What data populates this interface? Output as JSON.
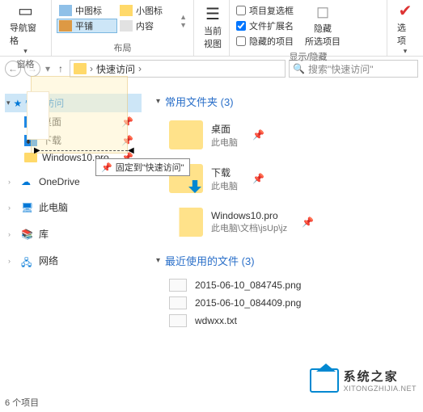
{
  "ribbon": {
    "panes": {
      "label": "窗格",
      "navpane": "导航窗格"
    },
    "layout": {
      "label": "布局",
      "medium": "中图标",
      "tiles": "平铺",
      "smallicons": "小图标",
      "content": "内容"
    },
    "currentview": {
      "label": "当前\n视图"
    },
    "showhide": {
      "label": "显示/隐藏",
      "checkboxes": "项目复选框",
      "extensions": "文件扩展名",
      "hiddenitems": "隐藏的项目",
      "hideBtn": "隐藏\n所选项目"
    },
    "options": "选项"
  },
  "breadcrumb": {
    "root": "快速访问",
    "sep": "›"
  },
  "search": {
    "placeholder": "搜索\"快速访问\""
  },
  "nav": {
    "quick": "快速访问",
    "desktop": "桌面",
    "downloads": "下载",
    "winpro": "Windows10.pro",
    "onedrive": "OneDrive",
    "thispc": "此电脑",
    "libraries": "库",
    "network": "网络"
  },
  "content": {
    "freqTitle": "常用文件夹 (3)",
    "recentTitle": "最近使用的文件 (3)",
    "folders": [
      {
        "name": "桌面",
        "sub": "此电脑"
      },
      {
        "name": "下载",
        "sub": "此电脑"
      },
      {
        "name": "Windows10.pro",
        "sub": "此电脑\\文档\\jsUp\\jz"
      }
    ],
    "files": [
      {
        "name": "2015-06-10_084745.png"
      },
      {
        "name": "2015-06-10_084409.png"
      },
      {
        "name": "wdwxx.txt"
      }
    ]
  },
  "tooltip": "固定到\"快速访问\"",
  "status": "6 个项目",
  "watermark": {
    "cn": "系统之家",
    "en": "XITONGZHIJIA.NET"
  }
}
